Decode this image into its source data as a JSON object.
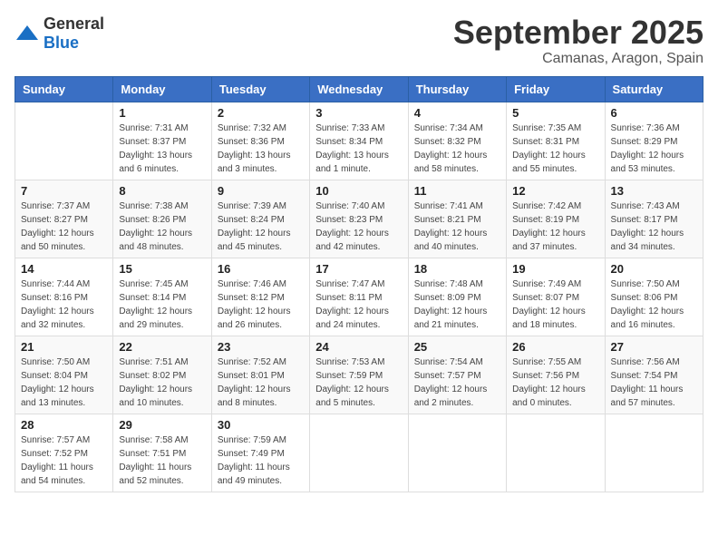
{
  "logo": {
    "general": "General",
    "blue": "Blue"
  },
  "header": {
    "month": "September 2025",
    "location": "Camanas, Aragon, Spain"
  },
  "weekdays": [
    "Sunday",
    "Monday",
    "Tuesday",
    "Wednesday",
    "Thursday",
    "Friday",
    "Saturday"
  ],
  "weeks": [
    [
      {
        "day": "",
        "info": ""
      },
      {
        "day": "1",
        "info": "Sunrise: 7:31 AM\nSunset: 8:37 PM\nDaylight: 13 hours\nand 6 minutes."
      },
      {
        "day": "2",
        "info": "Sunrise: 7:32 AM\nSunset: 8:36 PM\nDaylight: 13 hours\nand 3 minutes."
      },
      {
        "day": "3",
        "info": "Sunrise: 7:33 AM\nSunset: 8:34 PM\nDaylight: 13 hours\nand 1 minute."
      },
      {
        "day": "4",
        "info": "Sunrise: 7:34 AM\nSunset: 8:32 PM\nDaylight: 12 hours\nand 58 minutes."
      },
      {
        "day": "5",
        "info": "Sunrise: 7:35 AM\nSunset: 8:31 PM\nDaylight: 12 hours\nand 55 minutes."
      },
      {
        "day": "6",
        "info": "Sunrise: 7:36 AM\nSunset: 8:29 PM\nDaylight: 12 hours\nand 53 minutes."
      }
    ],
    [
      {
        "day": "7",
        "info": "Sunrise: 7:37 AM\nSunset: 8:27 PM\nDaylight: 12 hours\nand 50 minutes."
      },
      {
        "day": "8",
        "info": "Sunrise: 7:38 AM\nSunset: 8:26 PM\nDaylight: 12 hours\nand 48 minutes."
      },
      {
        "day": "9",
        "info": "Sunrise: 7:39 AM\nSunset: 8:24 PM\nDaylight: 12 hours\nand 45 minutes."
      },
      {
        "day": "10",
        "info": "Sunrise: 7:40 AM\nSunset: 8:23 PM\nDaylight: 12 hours\nand 42 minutes."
      },
      {
        "day": "11",
        "info": "Sunrise: 7:41 AM\nSunset: 8:21 PM\nDaylight: 12 hours\nand 40 minutes."
      },
      {
        "day": "12",
        "info": "Sunrise: 7:42 AM\nSunset: 8:19 PM\nDaylight: 12 hours\nand 37 minutes."
      },
      {
        "day": "13",
        "info": "Sunrise: 7:43 AM\nSunset: 8:17 PM\nDaylight: 12 hours\nand 34 minutes."
      }
    ],
    [
      {
        "day": "14",
        "info": "Sunrise: 7:44 AM\nSunset: 8:16 PM\nDaylight: 12 hours\nand 32 minutes."
      },
      {
        "day": "15",
        "info": "Sunrise: 7:45 AM\nSunset: 8:14 PM\nDaylight: 12 hours\nand 29 minutes."
      },
      {
        "day": "16",
        "info": "Sunrise: 7:46 AM\nSunset: 8:12 PM\nDaylight: 12 hours\nand 26 minutes."
      },
      {
        "day": "17",
        "info": "Sunrise: 7:47 AM\nSunset: 8:11 PM\nDaylight: 12 hours\nand 24 minutes."
      },
      {
        "day": "18",
        "info": "Sunrise: 7:48 AM\nSunset: 8:09 PM\nDaylight: 12 hours\nand 21 minutes."
      },
      {
        "day": "19",
        "info": "Sunrise: 7:49 AM\nSunset: 8:07 PM\nDaylight: 12 hours\nand 18 minutes."
      },
      {
        "day": "20",
        "info": "Sunrise: 7:50 AM\nSunset: 8:06 PM\nDaylight: 12 hours\nand 16 minutes."
      }
    ],
    [
      {
        "day": "21",
        "info": "Sunrise: 7:50 AM\nSunset: 8:04 PM\nDaylight: 12 hours\nand 13 minutes."
      },
      {
        "day": "22",
        "info": "Sunrise: 7:51 AM\nSunset: 8:02 PM\nDaylight: 12 hours\nand 10 minutes."
      },
      {
        "day": "23",
        "info": "Sunrise: 7:52 AM\nSunset: 8:01 PM\nDaylight: 12 hours\nand 8 minutes."
      },
      {
        "day": "24",
        "info": "Sunrise: 7:53 AM\nSunset: 7:59 PM\nDaylight: 12 hours\nand 5 minutes."
      },
      {
        "day": "25",
        "info": "Sunrise: 7:54 AM\nSunset: 7:57 PM\nDaylight: 12 hours\nand 2 minutes."
      },
      {
        "day": "26",
        "info": "Sunrise: 7:55 AM\nSunset: 7:56 PM\nDaylight: 12 hours\nand 0 minutes."
      },
      {
        "day": "27",
        "info": "Sunrise: 7:56 AM\nSunset: 7:54 PM\nDaylight: 11 hours\nand 57 minutes."
      }
    ],
    [
      {
        "day": "28",
        "info": "Sunrise: 7:57 AM\nSunset: 7:52 PM\nDaylight: 11 hours\nand 54 minutes."
      },
      {
        "day": "29",
        "info": "Sunrise: 7:58 AM\nSunset: 7:51 PM\nDaylight: 11 hours\nand 52 minutes."
      },
      {
        "day": "30",
        "info": "Sunrise: 7:59 AM\nSunset: 7:49 PM\nDaylight: 11 hours\nand 49 minutes."
      },
      {
        "day": "",
        "info": ""
      },
      {
        "day": "",
        "info": ""
      },
      {
        "day": "",
        "info": ""
      },
      {
        "day": "",
        "info": ""
      }
    ]
  ]
}
